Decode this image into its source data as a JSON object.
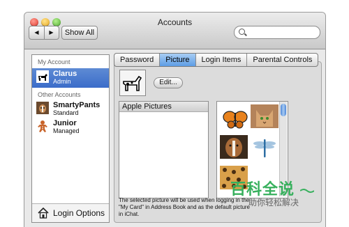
{
  "window": {
    "title": "Accounts"
  },
  "toolbar": {
    "show_all_label": "Show All",
    "back_label": "◀",
    "forward_label": "▶"
  },
  "search": {
    "placeholder": ""
  },
  "sidebar": {
    "my_account_heading": "My Account",
    "other_accounts_heading": "Other Accounts",
    "users": [
      {
        "name": "Clarus",
        "role": "Admin",
        "icon": "dog-cow-icon"
      },
      {
        "name": "SmartyPants",
        "role": "Standard",
        "icon": "dog-photo-icon"
      },
      {
        "name": "Junior",
        "role": "Managed",
        "icon": "gingerbread-icon"
      }
    ],
    "login_options_label": "Login Options"
  },
  "tabs": [
    {
      "label": "Password",
      "active": false
    },
    {
      "label": "Picture",
      "active": true
    },
    {
      "label": "Login Items",
      "active": false
    },
    {
      "label": "Parental Controls",
      "active": false
    }
  ],
  "picture": {
    "edit_label": "Edit...",
    "list_title": "Apple Pictures",
    "note": "The selected picture will be used when logging in the \"My Card\" in Address Book and as the default picture in iChat.",
    "images": [
      "butterfly-icon",
      "cat-icon",
      "dog-icon",
      "dragonfly-icon",
      "leopard-pattern-icon"
    ]
  },
  "watermark": {
    "line1": "百科全说",
    "line2": "助你轻松解决"
  },
  "colors": {
    "accent": "#3b6cc9",
    "tab_active": "#5d9de5",
    "watermark": "#37b05d"
  }
}
